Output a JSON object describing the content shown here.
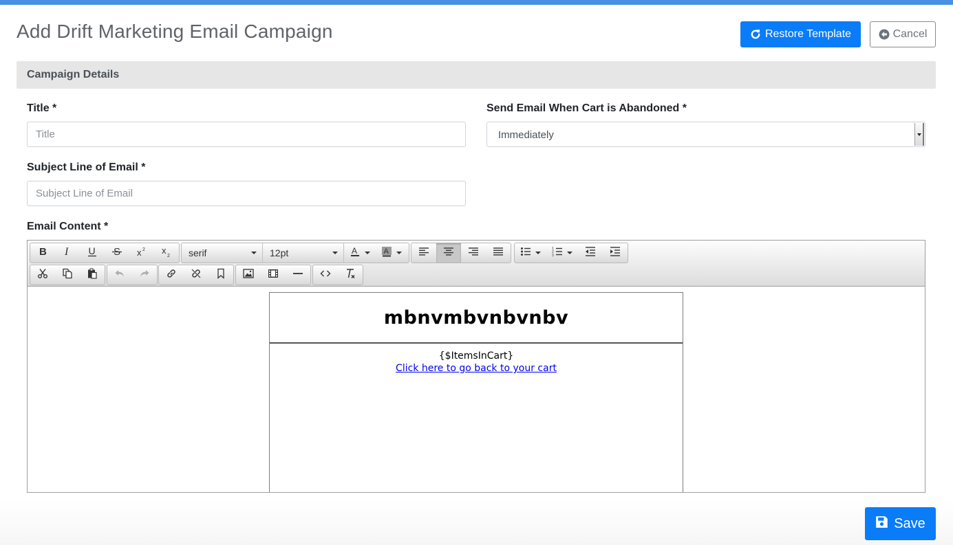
{
  "page": {
    "title": "Add Drift Marketing Email Campaign",
    "accent_color": "#4a90e2",
    "primary_color": "#0a7cf8"
  },
  "header_buttons": {
    "restore_label": "Restore Template",
    "restore_icon": "refresh-icon",
    "cancel_label": "Cancel",
    "cancel_icon": "arrow-circle-left-icon"
  },
  "section": {
    "title": "Campaign Details"
  },
  "form": {
    "title_label": "Title *",
    "title_placeholder": "Title",
    "title_value": "",
    "send_label": "Send Email When Cart is Abandoned *",
    "send_value": "Immediately",
    "subject_label": "Subject Line of Email *",
    "subject_placeholder": "Subject Line of Email",
    "subject_value": "",
    "content_label": "Email Content *"
  },
  "toolbar": {
    "font_family": "serif",
    "font_size": "12pt",
    "row1_icons": [
      "bold-icon",
      "italic-icon",
      "underline-icon",
      "strikethrough-icon",
      "superscript-icon",
      "subscript-icon",
      "text-color-icon",
      "background-color-icon",
      "align-left-icon",
      "align-center-icon",
      "align-right-icon",
      "align-justify-icon",
      "bullet-list-icon",
      "numbered-list-icon",
      "outdent-icon",
      "indent-icon"
    ],
    "row2_icons": [
      "cut-icon",
      "copy-icon",
      "paste-icon",
      "undo-icon",
      "redo-icon",
      "link-icon",
      "unlink-icon",
      "bookmark-icon",
      "image-icon",
      "media-icon",
      "horizontal-rule-icon",
      "source-code-icon",
      "clear-formatting-icon"
    ],
    "active_alignment": "center"
  },
  "email_preview": {
    "heading": "mbnvmbvnbvnbv",
    "items_placeholder": "{$ItemsInCart}",
    "link_text": "Click here to go back to your cart"
  },
  "footer": {
    "save_label": "Save",
    "save_icon": "save-icon"
  }
}
